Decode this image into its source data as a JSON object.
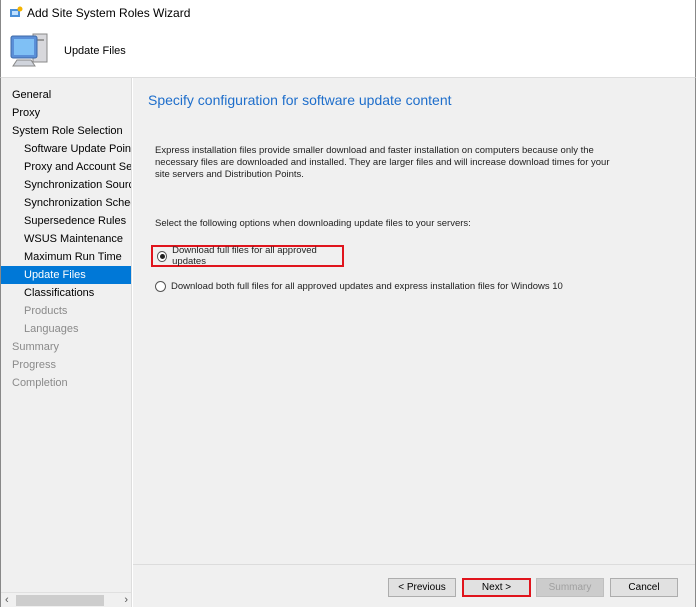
{
  "window": {
    "title": "Add Site System Roles Wizard"
  },
  "header": {
    "title": "Update Files"
  },
  "sidebar": {
    "items": [
      {
        "label": "General",
        "level": 0,
        "state": "normal"
      },
      {
        "label": "Proxy",
        "level": 0,
        "state": "normal"
      },
      {
        "label": "System Role Selection",
        "level": 0,
        "state": "normal"
      },
      {
        "label": "Software Update Point",
        "level": 1,
        "state": "normal"
      },
      {
        "label": "Proxy and Account Settings",
        "level": 1,
        "state": "normal"
      },
      {
        "label": "Synchronization Source",
        "level": 1,
        "state": "normal"
      },
      {
        "label": "Synchronization Schedule",
        "level": 1,
        "state": "normal"
      },
      {
        "label": "Supersedence Rules",
        "level": 1,
        "state": "normal"
      },
      {
        "label": "WSUS Maintenance",
        "level": 1,
        "state": "normal"
      },
      {
        "label": "Maximum Run Time",
        "level": 1,
        "state": "normal"
      },
      {
        "label": "Update Files",
        "level": 1,
        "state": "selected"
      },
      {
        "label": "Classifications",
        "level": 1,
        "state": "normal"
      },
      {
        "label": "Products",
        "level": 1,
        "state": "disabled"
      },
      {
        "label": "Languages",
        "level": 1,
        "state": "disabled"
      },
      {
        "label": "Summary",
        "level": 0,
        "state": "disabled"
      },
      {
        "label": "Progress",
        "level": 0,
        "state": "disabled"
      },
      {
        "label": "Completion",
        "level": 0,
        "state": "disabled"
      }
    ]
  },
  "main": {
    "title": "Specify configuration for software update content",
    "description": "Express installation files provide smaller download and faster installation on computers because only the necessary files are downloaded and installed.  They are larger files and will increase download times for your site servers and Distribution Points.",
    "prompt": "Select the following options when downloading update files to your servers:",
    "options": [
      {
        "label": "Download full files for all approved updates",
        "selected": true
      },
      {
        "label": "Download both full files for all approved updates and express installation files for Windows 10",
        "selected": false
      }
    ]
  },
  "buttons": {
    "previous": "< Previous",
    "next": "Next >",
    "summary": "Summary",
    "cancel": "Cancel"
  },
  "colors": {
    "accent": "#0078d7",
    "title": "#1e6ecb",
    "highlight": "#e0141c"
  }
}
